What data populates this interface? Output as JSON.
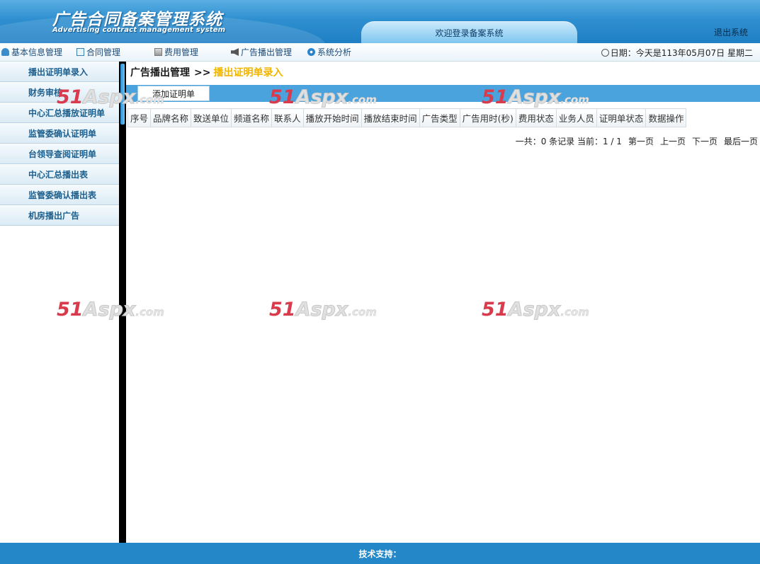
{
  "header": {
    "logo_cn": "广告合同备案管理系统",
    "logo_en": "Advertising contract management system",
    "welcome": "欢迎登录备案系统",
    "logout": "退出系统"
  },
  "menu": {
    "items": [
      {
        "label": "基本信息管理",
        "icon": "person-icon"
      },
      {
        "label": "合同管理",
        "icon": "document-icon"
      },
      {
        "label": "费用管理",
        "icon": "calculator-icon"
      },
      {
        "label": "广告播出管理",
        "icon": "speaker-icon"
      },
      {
        "label": "系统分析",
        "icon": "gear-icon"
      }
    ],
    "date": "日期：今天是113年05月07日 星期二"
  },
  "sidebar": {
    "items": [
      {
        "label": "播出证明单录入"
      },
      {
        "label": "财务审核"
      },
      {
        "label": "中心汇总播放证明单"
      },
      {
        "label": "监管委确认证明单"
      },
      {
        "label": "台领导查阅证明单"
      },
      {
        "label": "中心汇总播出表"
      },
      {
        "label": "监管委确认播出表"
      },
      {
        "label": "机房播出广告"
      }
    ]
  },
  "main": {
    "breadcrumb": {
      "root": "广告播出管理",
      "separator": ">>",
      "current": "播出证明单录入"
    },
    "add_button": "添加证明单",
    "columns": [
      "序号",
      "品牌名称",
      "致送单位",
      "频道名称",
      "联系人",
      "播放开始时间",
      "播放结束时间",
      "广告类型",
      "广告用时(秒)",
      "费用状态",
      "业务人员",
      "证明单状态",
      "数据操作"
    ],
    "pager": {
      "summary": "一共：0 条记录 当前：1 / 1",
      "first": "第一页",
      "prev": "上一页",
      "next": "下一页",
      "last": "最后一页"
    }
  },
  "watermark": {
    "num": "51",
    "brand": "Aspx",
    "suffix": ".com"
  },
  "footer": {
    "text": "技术支持："
  },
  "colors": {
    "header_blue": "#2e8fd0",
    "breadcrumb_current": "#f0b400",
    "toolbar_blue": "#4ba3dd",
    "footer_blue": "#2487c8"
  }
}
